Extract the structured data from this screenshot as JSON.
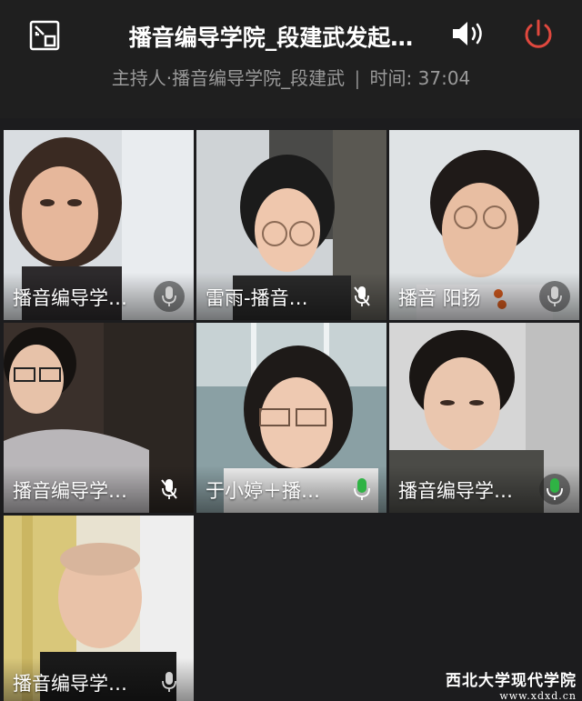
{
  "header": {
    "title": "播音编导学院_段建武发起…",
    "host_info": "主持人·播音编导学院_段建武",
    "separator": "|",
    "time_label": "时间: 37:04"
  },
  "icons": {
    "minimize": "minimize-window-icon",
    "speaker": "speaker-volume-icon",
    "power": "power-end-meeting-icon"
  },
  "colors": {
    "power": "#e0483e",
    "mic_active": "#2fb344",
    "background": "#1c1c1e"
  },
  "participants": [
    {
      "name": "播音编导学…",
      "mic": "idle"
    },
    {
      "name": "雷雨-播音…",
      "mic": "muted"
    },
    {
      "name": "播音 阳扬",
      "mic": "idle"
    },
    {
      "name": "播音编导学…",
      "mic": "muted"
    },
    {
      "name": "于小婷＋播…",
      "mic": "active"
    },
    {
      "name": "播音编导学…",
      "mic": "active"
    },
    {
      "name": "播音编导学…",
      "mic": "idle"
    }
  ],
  "watermark": {
    "line1": "西北大学现代学院",
    "line2": "www.xdxd.cn"
  }
}
